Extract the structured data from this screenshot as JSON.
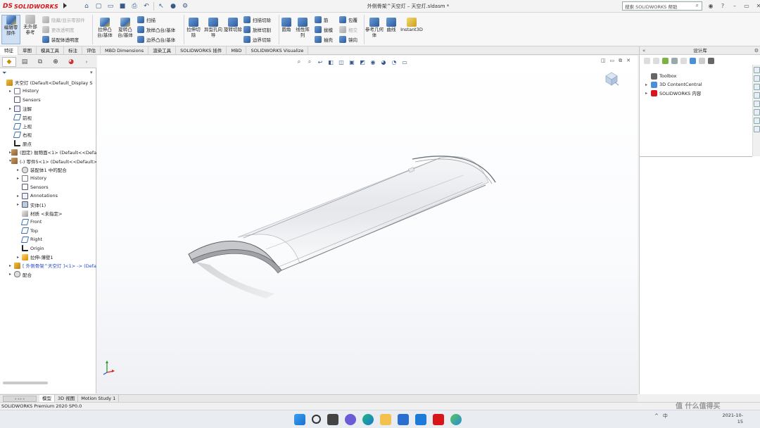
{
  "app": {
    "brand_ds": "DS",
    "brand": "SOLIDWORKS",
    "window_title": "外侧骨架^天空灯 – 天空灯.sldasm *",
    "search_placeholder": "搜索 SOLIDWORKS 帮助"
  },
  "ribbon": {
    "edit_component": "编辑零部件",
    "no_external_refs": "无外部参考",
    "hide_show_components": "隐藏/显示零部件",
    "change_transparency": "更改透明度",
    "assembly_transparency": "装配体透明度",
    "extrude_boss": "拉伸凸台/基体",
    "revolve_boss": "旋转凸台/基体",
    "sweep": "扫描",
    "loft_boss": "放样凸台/基体",
    "boundary_boss": "边界凸台/基体",
    "extrude_cut": "拉伸切除",
    "hole_wizard": "异型孔向导",
    "revolve_cut": "旋转切除",
    "sweep_cut": "扫描切除",
    "loft_cut": "放样切割",
    "boundary_cut": "边界切除",
    "fillet": "圆角",
    "linear_pattern": "线性阵列",
    "rib": "筋",
    "draft": "拔模",
    "shell": "抽壳",
    "wrap": "包覆",
    "intersect": "相交",
    "mirror": "镜向",
    "ref_geometry": "参考几何体",
    "curves": "曲线",
    "instant3d": "Instant3D"
  },
  "command_tabs": [
    "特征",
    "草图",
    "模具工具",
    "标注",
    "评估",
    "MBD Dimensions",
    "渲染工具",
    "SOLIDWORKS 插件",
    "MBD",
    "SOLIDWORKS Visualize"
  ],
  "feature_tree": [
    {
      "label": "天空灯  (Default<Default_Display S",
      "icon": "assembly-icon",
      "indent": 0,
      "expander": "",
      "style": "asm"
    },
    {
      "label": "History",
      "icon": "history-icon",
      "indent": 1,
      "expander": "▸",
      "style": "hist"
    },
    {
      "label": "Sensors",
      "icon": "sensors-icon",
      "indent": 1,
      "expander": "",
      "style": "sens"
    },
    {
      "label": "注解",
      "icon": "annotations-icon",
      "indent": 1,
      "expander": "▸",
      "style": "note"
    },
    {
      "label": "前视",
      "icon": "plane-icon",
      "indent": 1,
      "expander": "",
      "style": "plane"
    },
    {
      "label": "上视",
      "icon": "plane-icon",
      "indent": 1,
      "expander": "",
      "style": "plane"
    },
    {
      "label": "右视",
      "icon": "plane-icon",
      "indent": 1,
      "expander": "",
      "style": "plane"
    },
    {
      "label": "原点",
      "icon": "origin-icon",
      "indent": 1,
      "expander": "",
      "style": "orig"
    },
    {
      "label": "(固定) 抛物面<1> (Default<<Defa",
      "icon": "part-icon",
      "indent": 1,
      "expander": "▸",
      "style": "part"
    },
    {
      "label": "(-) 零件5<1> (Default<<Default>",
      "icon": "part-icon",
      "indent": 1,
      "expander": "▾",
      "style": "part"
    },
    {
      "label": "装配体1 中的配合",
      "icon": "mates-icon",
      "indent": 2,
      "expander": "▸",
      "style": "mate"
    },
    {
      "label": "History",
      "icon": "history-icon",
      "indent": 2,
      "expander": "▸",
      "style": "hist"
    },
    {
      "label": "Sensors",
      "icon": "sensors-icon",
      "indent": 2,
      "expander": "",
      "style": "sens"
    },
    {
      "label": "Annotations",
      "icon": "annotations-icon",
      "indent": 2,
      "expander": "▸",
      "style": "note"
    },
    {
      "label": "实体(1)",
      "icon": "solid-bodies-icon",
      "indent": 2,
      "expander": "▸",
      "style": "solid"
    },
    {
      "label": "材质 <未指定>",
      "icon": "material-icon",
      "indent": 2,
      "expander": "",
      "style": "mat"
    },
    {
      "label": "Front",
      "icon": "plane-icon",
      "indent": 2,
      "expander": "",
      "style": "plane"
    },
    {
      "label": "Top",
      "icon": "plane-icon",
      "indent": 2,
      "expander": "",
      "style": "plane"
    },
    {
      "label": "Right",
      "icon": "plane-icon",
      "indent": 2,
      "expander": "",
      "style": "plane"
    },
    {
      "label": "Origin",
      "icon": "origin-icon",
      "indent": 2,
      "expander": "",
      "style": "orig"
    },
    {
      "label": "拉伸-薄壁1",
      "icon": "extrude-feature-icon",
      "indent": 2,
      "expander": "▸",
      "style": "feat"
    },
    {
      "label": "[ 外侧骨架^天空灯 ]<1> -> (Defa",
      "icon": "assembly-icon",
      "indent": 1,
      "expander": "▸",
      "style": "asm",
      "highlight": true
    },
    {
      "label": "配合",
      "icon": "mates-icon",
      "indent": 1,
      "expander": "▸",
      "style": "mate"
    }
  ],
  "task_pane": {
    "title": "设计库",
    "items": [
      {
        "label": "Toolbox",
        "icon": "toolbox-icon",
        "expander": ""
      },
      {
        "label": "3D ContentCentral",
        "icon": "content-central-icon",
        "expander": "▸"
      },
      {
        "label": "SOLIDWORKS 内容",
        "icon": "solidworks-content-icon",
        "expander": "▸"
      }
    ]
  },
  "bottom_tabs": [
    "模型",
    "3D 视图",
    "Motion Study 1"
  ],
  "status": {
    "version": "SOLIDWORKS Premium 2020 SP0.0"
  },
  "taskbar": {
    "tray_lang": "中",
    "time": "",
    "date": "2021-10-15"
  },
  "watermark": "值 什么值得买",
  "colors": {
    "brand_red": "#d8151b",
    "accent_blue": "#2d5b9a",
    "highlight_text": "#2447c9"
  }
}
